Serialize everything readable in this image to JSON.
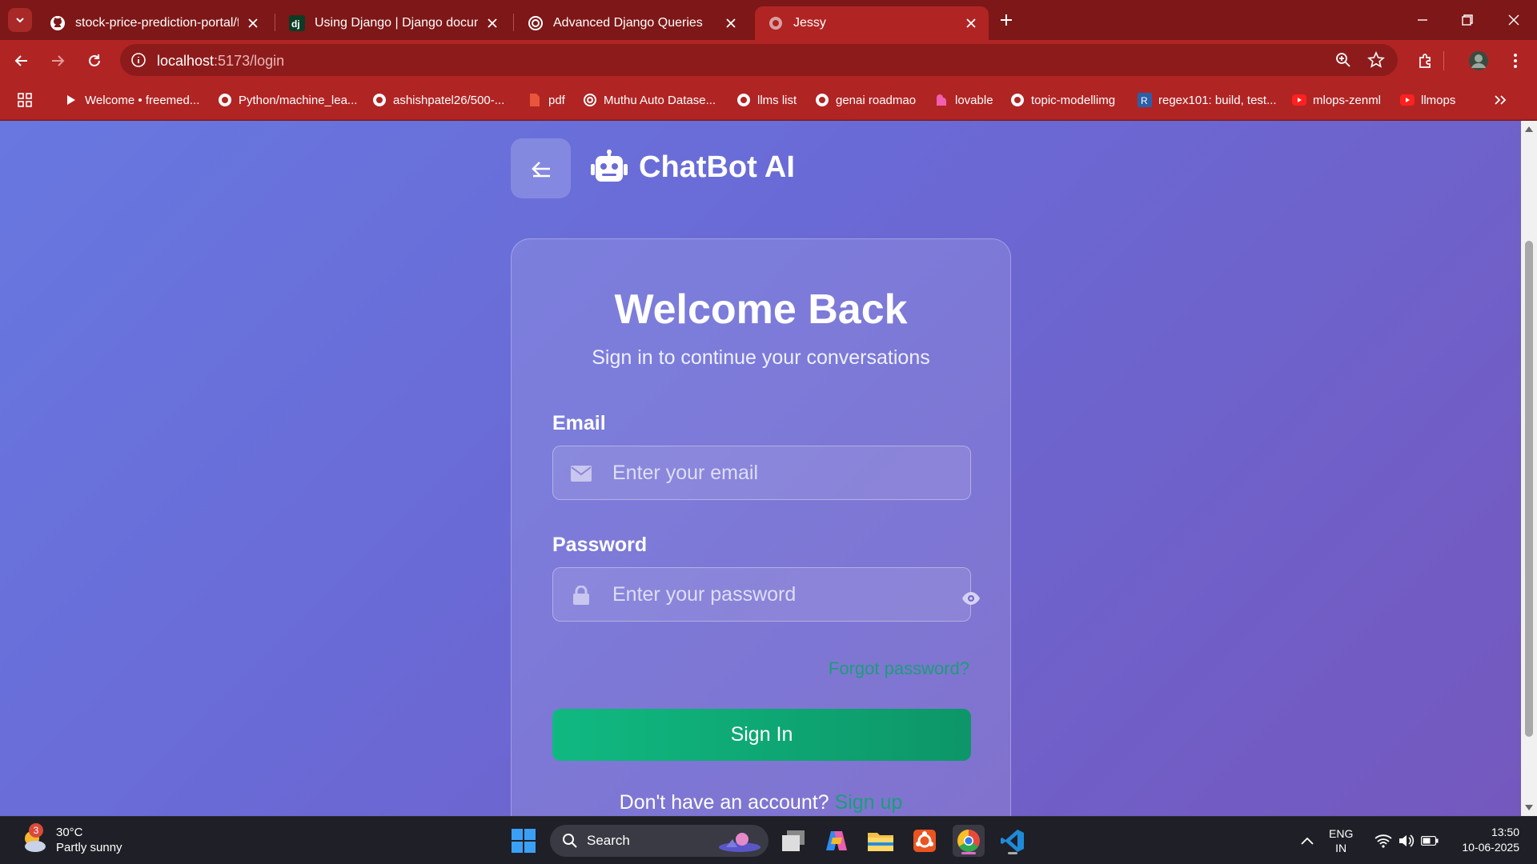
{
  "browser": {
    "tabs": [
      {
        "title": "stock-price-prediction-portal/fr",
        "icon": "github-icon"
      },
      {
        "title": "Using Django | Django docume",
        "icon": "django-icon"
      },
      {
        "title": "Advanced Django Queries",
        "icon": "openai-icon"
      },
      {
        "title": "Jessy",
        "icon": "globe-icon",
        "active": true
      }
    ],
    "url_host": "localhost",
    "url_path": ":5173/login",
    "bookmarks": [
      {
        "label": "Welcome • freemed...",
        "icon": "play-icon"
      },
      {
        "label": "Python/machine_lea...",
        "icon": "github-icon"
      },
      {
        "label": "ashishpatel26/500-...",
        "icon": "github-icon"
      },
      {
        "label": "pdf",
        "icon": "pdf-icon"
      },
      {
        "label": "Muthu Auto Datase...",
        "icon": "openai-icon"
      },
      {
        "label": "llms list",
        "icon": "github-icon"
      },
      {
        "label": "genai roadmao",
        "icon": "github-icon"
      },
      {
        "label": "lovable",
        "icon": "lovable-icon"
      },
      {
        "label": "topic-modellimg",
        "icon": "github-icon"
      },
      {
        "label": "regex101: build, test...",
        "icon": "regex-icon"
      },
      {
        "label": "mlops-zenml",
        "icon": "youtube-icon"
      },
      {
        "label": "llmops",
        "icon": "youtube-icon"
      }
    ]
  },
  "app": {
    "brand": "ChatBot AI",
    "title": "Welcome Back",
    "subtitle": "Sign in to continue your conversations",
    "email_label": "Email",
    "email_placeholder": "Enter your email",
    "password_label": "Password",
    "password_placeholder": "Enter your password",
    "forgot": "Forgot password?",
    "signin": "Sign In",
    "no_account": "Don't have an account?",
    "signup": "Sign up",
    "accent_color": "#10b981",
    "link_color": "#1a9e78"
  },
  "taskbar": {
    "weather_temp": "30°C",
    "weather_desc": "Partly sunny",
    "weather_badge": "3",
    "search": "Search",
    "lang_top": "ENG",
    "lang_bottom": "IN",
    "time": "13:50",
    "date": "10-06-2025"
  }
}
